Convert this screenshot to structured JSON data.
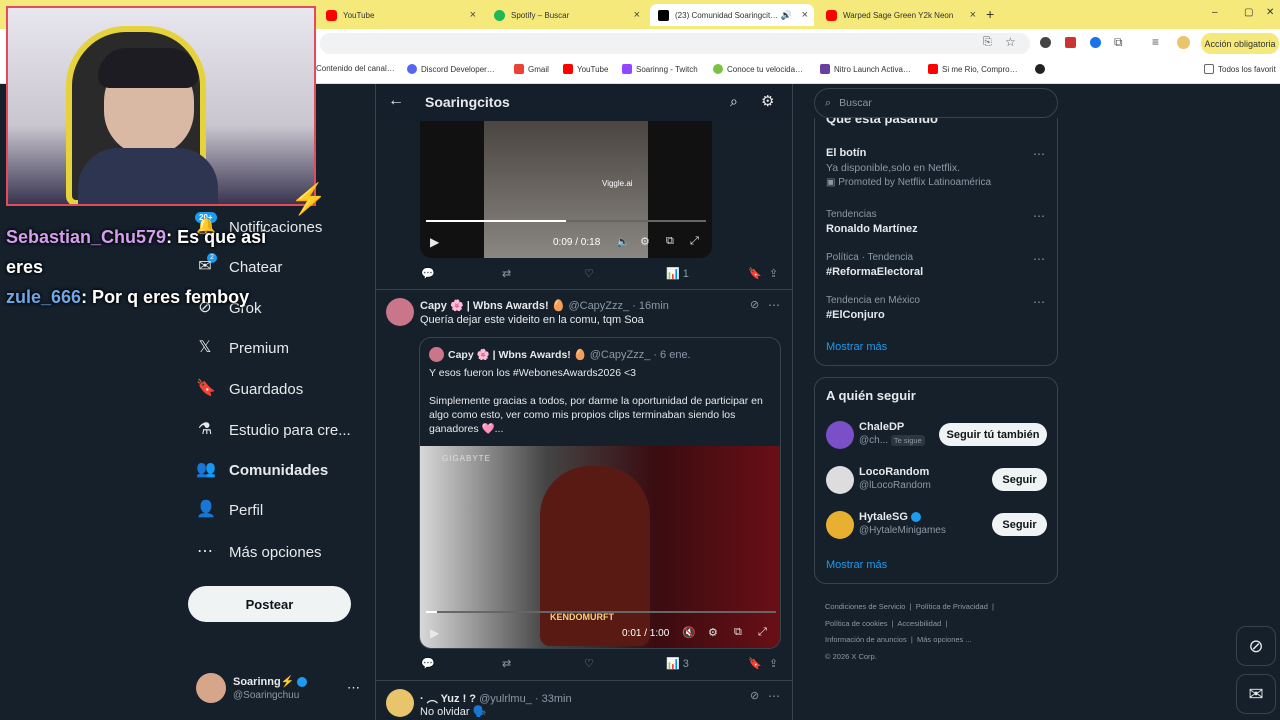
{
  "browser": {
    "tabs": [
      {
        "label": "YouTube",
        "color": "#ff0000"
      },
      {
        "label": "Spotify – Buscar",
        "color": "#1db954"
      },
      {
        "label": "(23) Comunidad Soaringcit…",
        "color": "#000000"
      },
      {
        "label": "Warped Sage Green Y2k Neon",
        "color": "#ff0000"
      }
    ],
    "new_tab": "+",
    "window_controls": [
      "–",
      "▢",
      "✕"
    ],
    "action_required": "Acción obligatoria",
    "bookmarks": [
      "Contenido del canal…",
      "Discord Developer…",
      "Gmail",
      "YouTube",
      "Soarinng - Twitch",
      "Conoce tu velocida…",
      "Nitro Launch Activa…",
      "Si me Rio, Compro…"
    ],
    "bookmarks_folder": "Todos los favorit"
  },
  "stream": {
    "chat": [
      {
        "user": "Sebastian_Chu579",
        "text": ": Es que asi",
        "cont": "eres",
        "color": "#d39ef0"
      },
      {
        "user": "zule_666",
        "text": ": Por q eres femboy",
        "color": "#6ea6e6"
      }
    ]
  },
  "sidebar": {
    "badges": {
      "notifications": "20+",
      "chat": "2"
    },
    "items": [
      {
        "label": "Notificaciones",
        "icon": "bell-icon"
      },
      {
        "label": "Chatear",
        "icon": "mail-icon"
      },
      {
        "label": "Grok",
        "icon": "grok-icon"
      },
      {
        "label": "Premium",
        "icon": "x-logo-icon"
      },
      {
        "label": "Guardados",
        "icon": "bookmark-icon"
      },
      {
        "label": "Estudio para cre...",
        "icon": "flask-icon"
      },
      {
        "label": "Comunidades",
        "icon": "people-icon"
      },
      {
        "label": "Perfil",
        "icon": "person-icon"
      },
      {
        "label": "Más opciones",
        "icon": "more-icon"
      }
    ],
    "post_button": "Postear",
    "account": {
      "name": "Soarinng⚡",
      "handle": "@Soaringchuu"
    }
  },
  "feed": {
    "title": "Soaringcitos",
    "video1": {
      "time": "0:09 / 0:18",
      "watermark": "Viggle.ai"
    },
    "actions1": {
      "views": "1"
    },
    "tweet2": {
      "name": "Capy 🌸 | Wbns Awards! 🥚",
      "handle": "@CapyZzz_",
      "time": "· 16min",
      "text": "Quería dejar este videito en la comu, tqm Soa",
      "quote": {
        "name": "Capy 🌸 | Wbns Awards! 🥚",
        "handle": "@CapyZzz_",
        "time": "· 6 ene.",
        "line1": "Y esos fueron los #WebonesAwards2026 <3",
        "line2": "Simplemente gracias a todos, por darme la oportunidad de participar en algo como esto, ver como mis propios clips terminaban siendo los ganadores 🩷...",
        "video": {
          "time": "0:01 / 1:00",
          "brand": "GIGABYTE",
          "caption": "KENDOMURFT"
        }
      },
      "views": "3"
    },
    "tweet3": {
      "name": "· ︵ Yuz ! ?",
      "handle": "@yulrlmu_",
      "time": "· 33min",
      "text": "No olvidar 🗣️"
    }
  },
  "right": {
    "search_placeholder": "Buscar",
    "trends_title": "Qué está pasando",
    "trends": [
      {
        "top": "El botín",
        "mid": "Ya disponible,solo en Netflix.",
        "promo": "Promoted by Netflix Latinoamérica"
      },
      {
        "top": "Tendencias",
        "name": "Ronaldo Martínez"
      },
      {
        "top": "Política · Tendencia",
        "name": "#ReformaElectoral"
      },
      {
        "top": "Tendencia en México",
        "name": "#ElConjuro"
      }
    ],
    "show_more": "Mostrar más",
    "who_title": "A quién seguir",
    "who": [
      {
        "name": "ChaleDP",
        "handle": "@ch...",
        "follows_you": "Te sigue",
        "button": "Seguir tú también"
      },
      {
        "name": "LocoRandom",
        "handle": "@lLocoRandom",
        "button": "Seguir"
      },
      {
        "name": "HytaleSG",
        "handle": "@HytaleMinigames",
        "button": "Seguir"
      }
    ],
    "show_more2": "Mostrar más",
    "footer": [
      "Condiciones de Servicio",
      "Política de Privacidad",
      "Política de cookies",
      "Accesibilidad",
      "Información de anuncios",
      "Más opciones ...",
      "© 2026 X Corp."
    ]
  },
  "colors": {
    "bg": "#15202b",
    "accent": "#1d9bf0",
    "border": "#38444d"
  }
}
